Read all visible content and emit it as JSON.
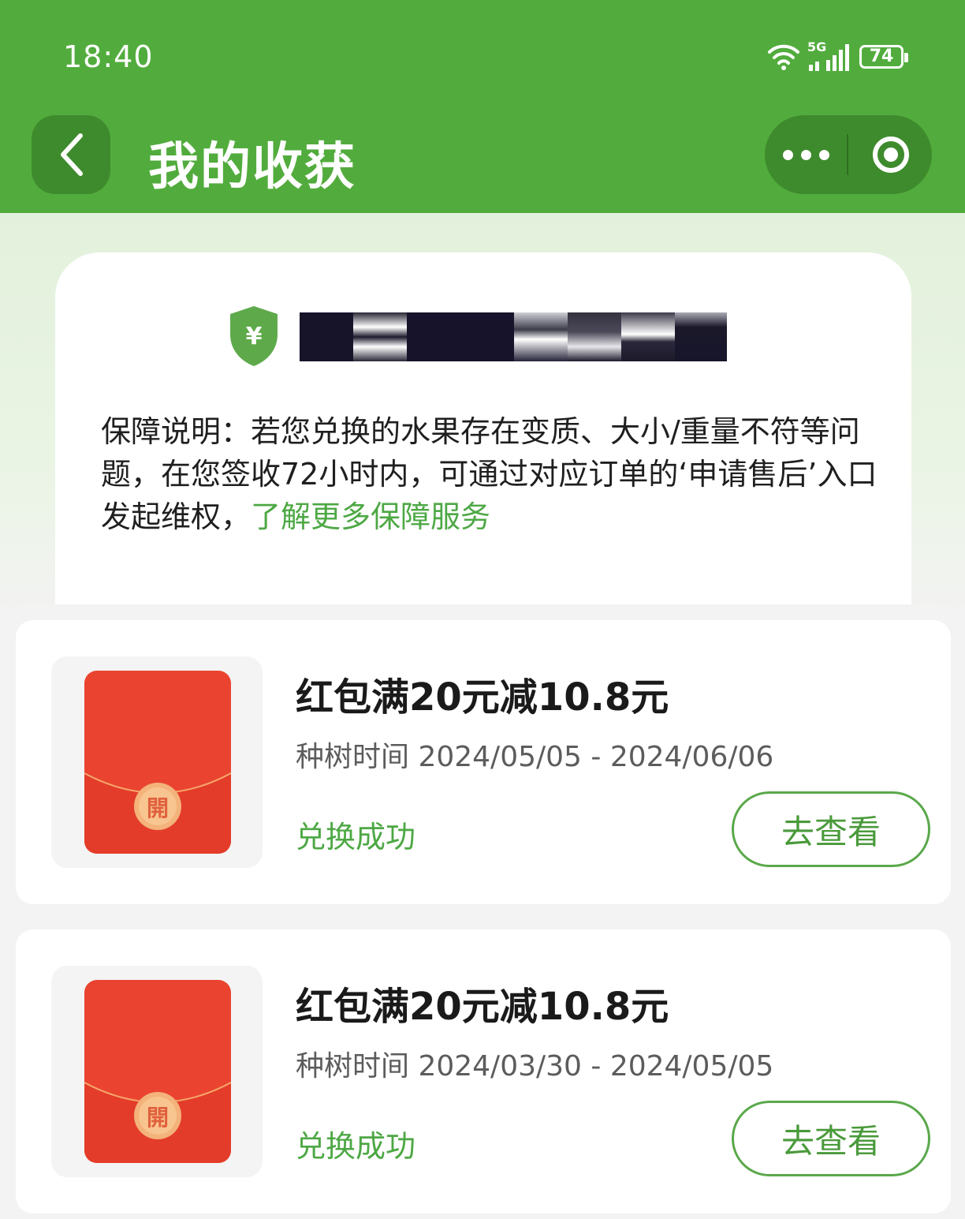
{
  "status_bar": {
    "time": "18:40",
    "network": "5G",
    "battery": "74"
  },
  "header": {
    "title": "我的收获"
  },
  "guarantee": {
    "description": "保障说明：若您兑换的水果存在变质、大小/重量不符等问题，在您签收72小时内，可通过对应订单的‘申请售后’入口发起维权，",
    "link_text": "了解更多保障服务",
    "shield_symbol": "¥"
  },
  "rewards": [
    {
      "title": "红包满20元减10.8元",
      "time": "种树时间 2024/05/05 - 2024/06/06",
      "status": "兑换成功",
      "action": "去查看",
      "seal_char": "開"
    },
    {
      "title": "红包满20元减10.8元",
      "time": "种树时间 2024/03/30 - 2024/05/05",
      "status": "兑换成功",
      "action": "去查看",
      "seal_char": "開"
    }
  ],
  "colors": {
    "brand_green": "#52ac3d",
    "capsule_green": "#3e8b2d",
    "link_green": "#4da844",
    "envelope_red": "#ea4431"
  }
}
